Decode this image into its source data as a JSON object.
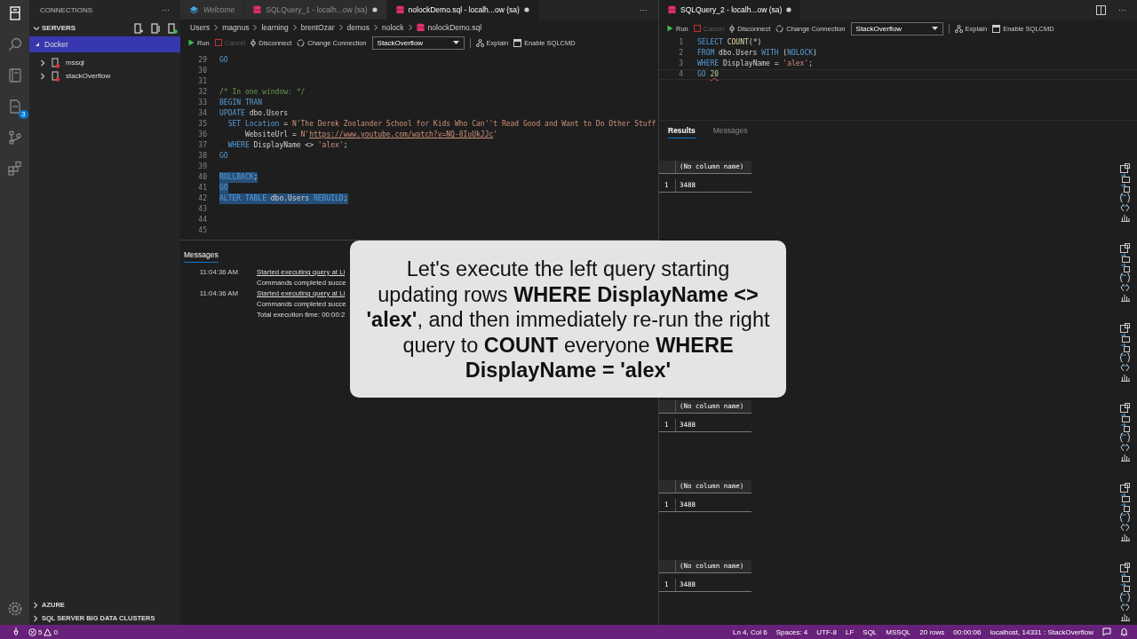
{
  "activity_bar": {
    "items": [
      {
        "kind": "servers",
        "selected": true
      },
      {
        "kind": "search",
        "selected": false
      },
      {
        "kind": "notebook",
        "selected": false
      },
      {
        "kind": "document",
        "selected": false,
        "badge": "3"
      },
      {
        "kind": "branch",
        "selected": false
      },
      {
        "kind": "blocks",
        "selected": false
      }
    ],
    "settings": {
      "kind": "gear"
    }
  },
  "sidebar": {
    "title": "CONNECTIONS",
    "more": "···",
    "section": {
      "label": "SERVERS",
      "expanded": true
    },
    "tree": [
      {
        "label": "Docker",
        "selected": true,
        "expanded": true,
        "children": [
          {
            "label": "mssql",
            "selected": false,
            "expanded": false
          },
          {
            "label": "stackOverflow",
            "selected": false,
            "expanded": false
          }
        ]
      }
    ],
    "bottom_sections": [
      {
        "label": "AZURE",
        "expanded": false
      },
      {
        "label": "SQL SERVER BIG DATA CLUSTERS",
        "expanded": false
      }
    ]
  },
  "left_editor": {
    "tabs": [
      {
        "kind": "welcome",
        "label": "Welcome",
        "selected": false,
        "dirty": false
      },
      {
        "kind": "query",
        "label": "SQLQuery_1 - localh...ow (sa)",
        "selected": false,
        "dirty": true
      },
      {
        "kind": "query",
        "label": "nolockDemo.sql - localh...ow (sa)",
        "selected": true,
        "dirty": true
      }
    ],
    "more": "···",
    "breadcrumbs": [
      "Users",
      "magnus",
      "learning",
      "brentOzar",
      "demos",
      "nolock",
      "nolockDemo.sql"
    ],
    "toolbar": {
      "run": "Run",
      "cancel": {
        "label": "Cancel",
        "disabled": true
      },
      "disconnect": "Disconnect",
      "change_connection": "Change Connection",
      "database": "StackOverflow",
      "explain": "Explain",
      "sqlcmd": "Enable SQLCMD"
    },
    "lines": [
      {
        "number": "29",
        "selected": false,
        "tokens": [
          {
            "kind": "kw",
            "text": "GO"
          }
        ]
      },
      {
        "number": "30"
      },
      {
        "number": "31"
      },
      {
        "number": "32",
        "selected": false,
        "tokens": [
          {
            "kind": "comment",
            "text": "/* In one window: */"
          }
        ]
      },
      {
        "number": "33",
        "selected": false,
        "tokens": [
          {
            "kind": "kw",
            "text": "BEGIN TRAN"
          }
        ]
      },
      {
        "number": "34",
        "selected": false,
        "tokens": [
          {
            "kind": "kw",
            "text": "UPDATE"
          },
          {
            "kind": "text",
            "text": " dbo.Users"
          }
        ]
      },
      {
        "number": "35",
        "selected": false,
        "tokens": [
          {
            "kind": "kw",
            "text": "  SET Location"
          },
          {
            "kind": "text",
            "text": " = "
          },
          {
            "kind": "str",
            "text": "N'The Derek Zoolander School for Kids Who Can''t Read Good and Want to Do Other Stuff"
          }
        ]
      },
      {
        "number": "36",
        "selected": false,
        "tokens": [
          {
            "kind": "text",
            "text": "      WebsiteUrl = "
          },
          {
            "kind": "str",
            "text": "N'"
          },
          {
            "kind": "link",
            "text": "https://www.youtube.com/watch?v=NQ-8IuUkJJc"
          },
          {
            "kind": "str",
            "text": "'"
          }
        ]
      },
      {
        "number": "37",
        "selected": false,
        "tokens": [
          {
            "kind": "kw",
            "text": "  WHERE"
          },
          {
            "kind": "text",
            "text": " DisplayName <> "
          },
          {
            "kind": "str",
            "text": "'alex'"
          },
          {
            "kind": "text",
            "text": ";"
          }
        ]
      },
      {
        "number": "38",
        "selected": false,
        "tokens": [
          {
            "kind": "kw",
            "text": "GO"
          }
        ]
      },
      {
        "number": "39"
      },
      {
        "number": "40",
        "selected": true,
        "tokens": [
          {
            "kind": "kw",
            "text": "ROLLBACK"
          },
          {
            "kind": "text",
            "text": ";"
          }
        ]
      },
      {
        "number": "41",
        "selected": true,
        "tokens": [
          {
            "kind": "kw",
            "text": "GO"
          }
        ]
      },
      {
        "number": "42",
        "selected": true,
        "tokens": [
          {
            "kind": "kw",
            "text": "ALTER TABLE"
          },
          {
            "kind": "text",
            "text": " dbo.Users "
          },
          {
            "kind": "kw",
            "text": "REBUILD"
          },
          {
            "kind": "text",
            "text": ";"
          }
        ]
      },
      {
        "number": "43"
      },
      {
        "number": "44"
      },
      {
        "number": "45"
      }
    ],
    "messages": {
      "title": "Messages",
      "rows": [
        {
          "time": "11:04:36 AM",
          "text": "Started executing query at Li",
          "link": true
        },
        {
          "text": "Commands completed succe",
          "link": false
        },
        {
          "time": "11:04:36 AM",
          "text": "Started executing query at Li",
          "link": true
        },
        {
          "text": "Commands completed succe",
          "link": false
        },
        {
          "text": "Total execution time: 00:00:2",
          "link": false
        }
      ]
    }
  },
  "right_editor": {
    "tabs": [
      {
        "kind": "query",
        "label": "SQLQuery_2 - localh...ow (sa)",
        "selected": true,
        "dirty": true
      }
    ],
    "more": "···",
    "toolbar": {
      "run": "Run",
      "cancel": {
        "label": "Cancel",
        "disabled": true
      },
      "disconnect": "Disconnect",
      "change_connection": "Change Connection",
      "database": "StackOverflow",
      "explain": "Explain",
      "sqlcmd": "Enable SQLCMD"
    },
    "lines": [
      {
        "number": "1",
        "current": false,
        "tokens": [
          {
            "kind": "kw",
            "text": "SELECT "
          },
          {
            "kind": "fn",
            "text": "COUNT"
          },
          {
            "kind": "text",
            "text": "(*)"
          }
        ]
      },
      {
        "number": "2",
        "current": false,
        "tokens": [
          {
            "kind": "kw",
            "text": "FROM"
          },
          {
            "kind": "text",
            "text": " dbo.Users "
          },
          {
            "kind": "kw",
            "text": "WITH"
          },
          {
            "kind": "text",
            "text": " ("
          },
          {
            "kind": "kw",
            "text": "NOLOCK"
          },
          {
            "kind": "text",
            "text": ")"
          }
        ]
      },
      {
        "number": "3",
        "current": false,
        "tokens": [
          {
            "kind": "kw",
            "text": "WHERE"
          },
          {
            "kind": "text",
            "text": " DisplayName = "
          },
          {
            "kind": "str",
            "text": "'alex'"
          },
          {
            "kind": "text",
            "text": ";"
          }
        ]
      },
      {
        "number": "4",
        "current": true,
        "tokens": [
          {
            "kind": "kw",
            "text": "GO "
          },
          {
            "kind": "err",
            "text": "20"
          }
        ]
      }
    ],
    "result_tabs": [
      {
        "label": "Results",
        "selected": true
      },
      {
        "label": "Messages",
        "selected": false
      }
    ],
    "result_sets": [
      {
        "kind": "grid",
        "column": "(No column name)",
        "rows": [
          {
            "number": "1",
            "value": "3488"
          }
        ]
      },
      {
        "kind": "covered"
      },
      {
        "kind": "covered"
      },
      {
        "kind": "grid",
        "column": "(No column name)",
        "rows": [
          {
            "number": "1",
            "value": "3488"
          }
        ]
      },
      {
        "kind": "grid",
        "column": "(No column name)",
        "rows": [
          {
            "number": "1",
            "value": "3488"
          }
        ]
      },
      {
        "kind": "grid",
        "column": "(No column name)",
        "rows": [
          {
            "number": "1",
            "value": "3488"
          }
        ]
      }
    ]
  },
  "callout": {
    "text": "Let's execute the left query starting updating rows **WHERE DisplayName <> 'alex'**, and then immediately re-run the right query to **COUNT** everyone **WHERE DisplayName = 'alex'**"
  },
  "status_bar": {
    "problems": {
      "errors": "5",
      "warnings": "0"
    },
    "items": [
      "Ln 4, Col 6",
      "Spaces: 4",
      "UTF-8",
      "LF",
      "SQL",
      "MSSQL",
      "20 rows",
      "00:00:06",
      "localhost, 14331 : StackOverflow"
    ]
  }
}
